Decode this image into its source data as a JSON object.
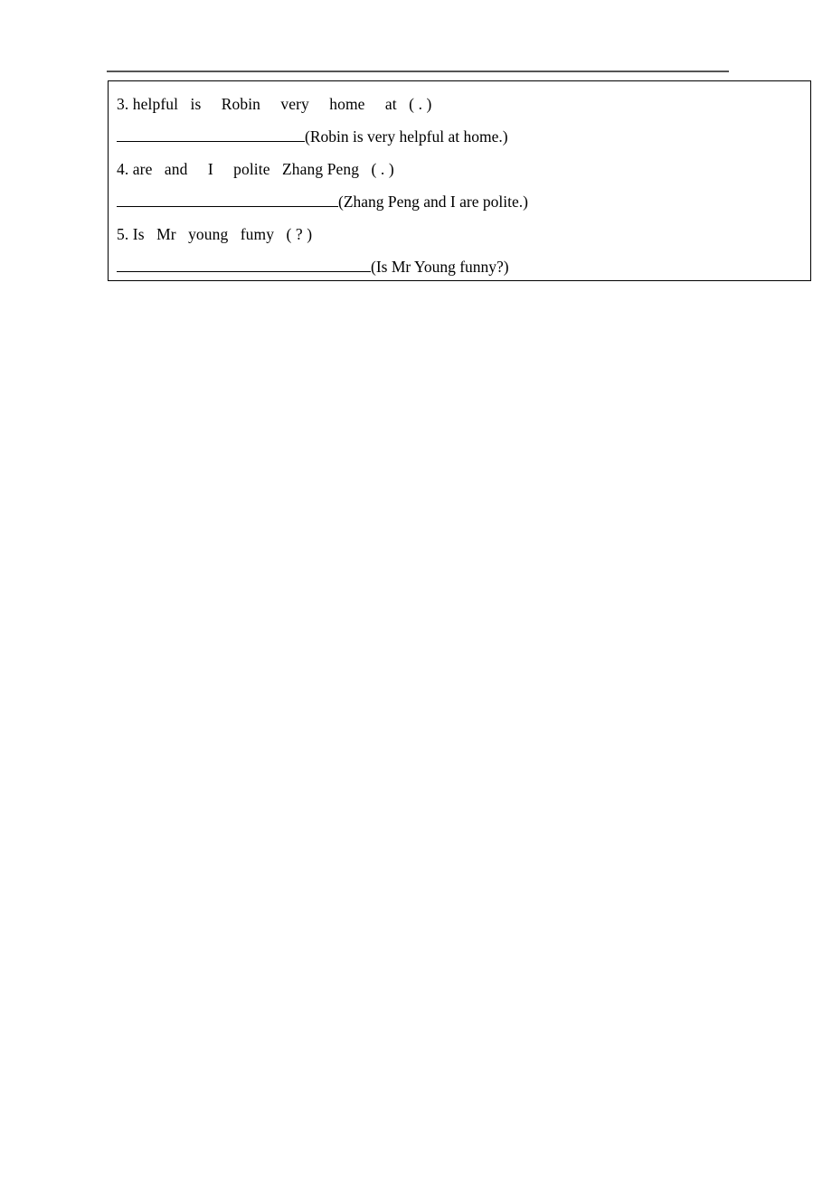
{
  "page": {
    "background_color": "#ffffff",
    "text_color": "#000000",
    "rule_color": "#555555",
    "border_color": "#000000"
  },
  "exercise_box": {
    "items": [
      {
        "number": "3.",
        "prompt": "3. helpful   is     Robin     very     home     at   ( . )",
        "scrambled_words": [
          "helpful",
          "is",
          "Robin",
          "very",
          "home",
          "at"
        ],
        "punctuation": "( . )",
        "answer": "(Robin is very helpful at home.)",
        "blank_label": "answer-blank-3"
      },
      {
        "number": "4.",
        "prompt": "4. are   and     I     polite   Zhang Peng   ( . )",
        "scrambled_words": [
          "are",
          "and",
          "I",
          "polite",
          "Zhang Peng"
        ],
        "punctuation": "( . )",
        "answer": "(Zhang Peng and I are polite.)",
        "blank_label": "answer-blank-4"
      },
      {
        "number": "5.",
        "prompt": "5. Is   Mr   young   fumy   ( ? )",
        "scrambled_words": [
          "Is",
          "Mr",
          "young",
          "fumy"
        ],
        "punctuation": "( ? )",
        "answer": "(Is Mr Young funny?)",
        "blank_label": "answer-blank-5"
      }
    ]
  }
}
